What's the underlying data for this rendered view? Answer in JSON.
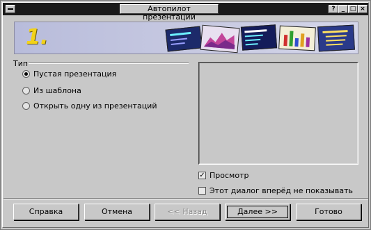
{
  "window": {
    "title": "Автопилот презентаций",
    "controls": [
      "?",
      "_",
      "□",
      "×"
    ]
  },
  "banner": {
    "step_number": "1.",
    "colors": {
      "background": "#c4c6df",
      "number": "#f2d21a"
    }
  },
  "type_group": {
    "label": "Тип",
    "options": [
      {
        "label": "Пустая презентация",
        "selected": true
      },
      {
        "label": "Из шаблона",
        "selected": false
      },
      {
        "label": "Открыть одну из презентаций",
        "selected": false
      }
    ]
  },
  "preview": {
    "checkbox_label": "Просмотр",
    "checkbox_checked": true,
    "dont_show_label": "Этот диалог вперёд не показывать",
    "dont_show_checked": false
  },
  "buttons": {
    "help": "Справка",
    "cancel": "Отмена",
    "back": "<< Назад",
    "next": "Далее >>",
    "finish": "Готово"
  }
}
